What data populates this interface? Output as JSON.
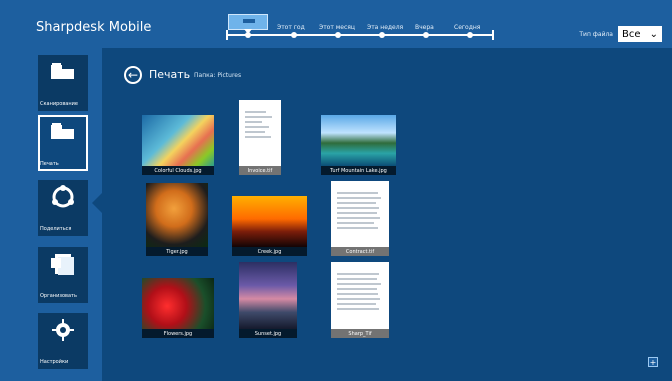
{
  "app": {
    "name": "Sharpdesk Mobile"
  },
  "timeline": {
    "labels": [
      "Этот год",
      "Этот месяц",
      "Эта неделя",
      "Вчера",
      "Сегодня"
    ]
  },
  "filter": {
    "label": "Тип файла",
    "value": "Все"
  },
  "sidebar": {
    "items": [
      {
        "label": "Сканирование",
        "icon": "scanner-icon"
      },
      {
        "label": "Печать",
        "icon": "printer-icon",
        "selected": true
      },
      {
        "label": "Поделиться",
        "icon": "share-icon"
      },
      {
        "label": "Организовать",
        "icon": "files-icon"
      },
      {
        "label": "Настройки",
        "icon": "gear-icon"
      }
    ]
  },
  "main": {
    "title": "Печать",
    "folder": "Папка: Pictures",
    "files": [
      {
        "name": "Colorful Clouds.jpg"
      },
      {
        "name": "Invoice.tif"
      },
      {
        "name": "Turf Mountain Lake.jpg"
      },
      {
        "name": "Tiger.jpg"
      },
      {
        "name": "Creek.jpg"
      },
      {
        "name": "Contract.tif"
      },
      {
        "name": "Flowers.jpg"
      },
      {
        "name": "Sunset.jpg"
      },
      {
        "name": "Sharp_Tif"
      }
    ]
  },
  "colors": {
    "background": "#1d5f9f",
    "content": "#0e487d",
    "sidebar_item": "#0b3a64"
  }
}
